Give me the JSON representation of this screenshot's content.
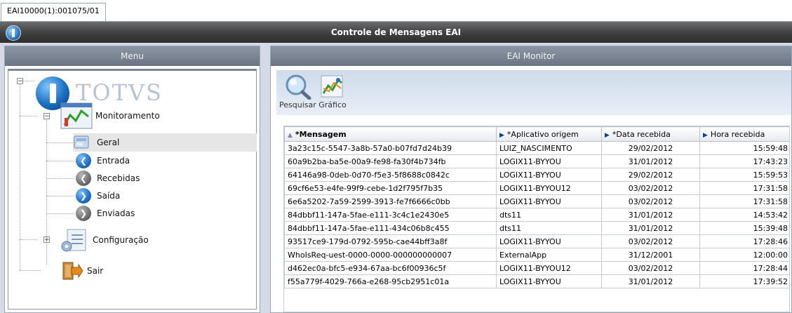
{
  "tab": {
    "label": "EAI10000(1):001075/01"
  },
  "window": {
    "title": "Controle de Mensagens EAI"
  },
  "menu_panel": {
    "title": "Menu",
    "logo_text": "TOTVS",
    "tree": {
      "monitoramento": {
        "label": "Monitoramento",
        "expander": "−"
      },
      "items": [
        {
          "label": "Geral"
        },
        {
          "label": "Entrada"
        },
        {
          "label": "Recebidas"
        },
        {
          "label": "Saída"
        },
        {
          "label": "Enviadas"
        }
      ],
      "configuracao": {
        "label": "Configuração",
        "expander": "+"
      },
      "sair": {
        "label": "Sair"
      }
    }
  },
  "monitor_panel": {
    "title": "EAI Monitor",
    "toolbar": {
      "search_label": "Pesquisar",
      "chart_label": "Gráfico"
    },
    "table": {
      "columns": [
        "*Mensagem",
        "*Aplicativo origem",
        "*Data recebida",
        "Hora recebida"
      ],
      "rows": [
        [
          "3a23c15c-5547-3a8b-57a0-b07fd7d24b39",
          "LUIZ_NASCIMENTO",
          "29/02/2012",
          "15:59:48"
        ],
        [
          "60a9b2ba-ba5e-00a9-fe98-fa30f4b734fb",
          "LOGIX11-BYYOU",
          "31/01/2012",
          "17:43:23"
        ],
        [
          "64146a98-0deb-0d70-f5e3-5f8688c0842c",
          "LOGIX11-BYYOU",
          "29/02/2012",
          "15:59:53"
        ],
        [
          "69cf6e53-e4fe-99f9-cebe-1d2f795f7b35",
          "LOGIX11-BYYOU12",
          "03/02/2012",
          "17:31:58"
        ],
        [
          "6e6a5202-7a59-2599-3913-fe7f6666c0bb",
          "LOGIX11-BYYOU",
          "03/02/2012",
          "17:31:58"
        ],
        [
          "84dbbf11-147a-5fae-e111-3c4c1e2430e5",
          "dts11",
          "31/01/2012",
          "14:53:42"
        ],
        [
          "84dbbf11-147a-5fae-e111-434c06b8c455",
          "dts11",
          "31/01/2012",
          "15:39:48"
        ],
        [
          "93517ce9-179d-0792-595b-cae44bff3a8f",
          "LOGIX11-BYYOU",
          "03/02/2012",
          "17:28:46"
        ],
        [
          "WhoIsReq-uest-0000-0000-000000000007",
          "ExternalApp",
          "31/12/2001",
          "12:00:00"
        ],
        [
          "d462ec0a-bfc5-e934-67aa-bc6f00936c5f",
          "LOGIX11-BYYOU12",
          "03/02/2012",
          "17:28:44"
        ],
        [
          "f55a779f-4029-766a-e268-95cb2951c01a",
          "LOGIX11-BYYOU",
          "31/01/2012",
          "17:39:52"
        ]
      ]
    }
  },
  "colors": {
    "titlebar": "#3f3f3f",
    "panel_header": "#7a8492",
    "toolbar": "#dfe7f1",
    "selection": "#e6e6e6"
  }
}
